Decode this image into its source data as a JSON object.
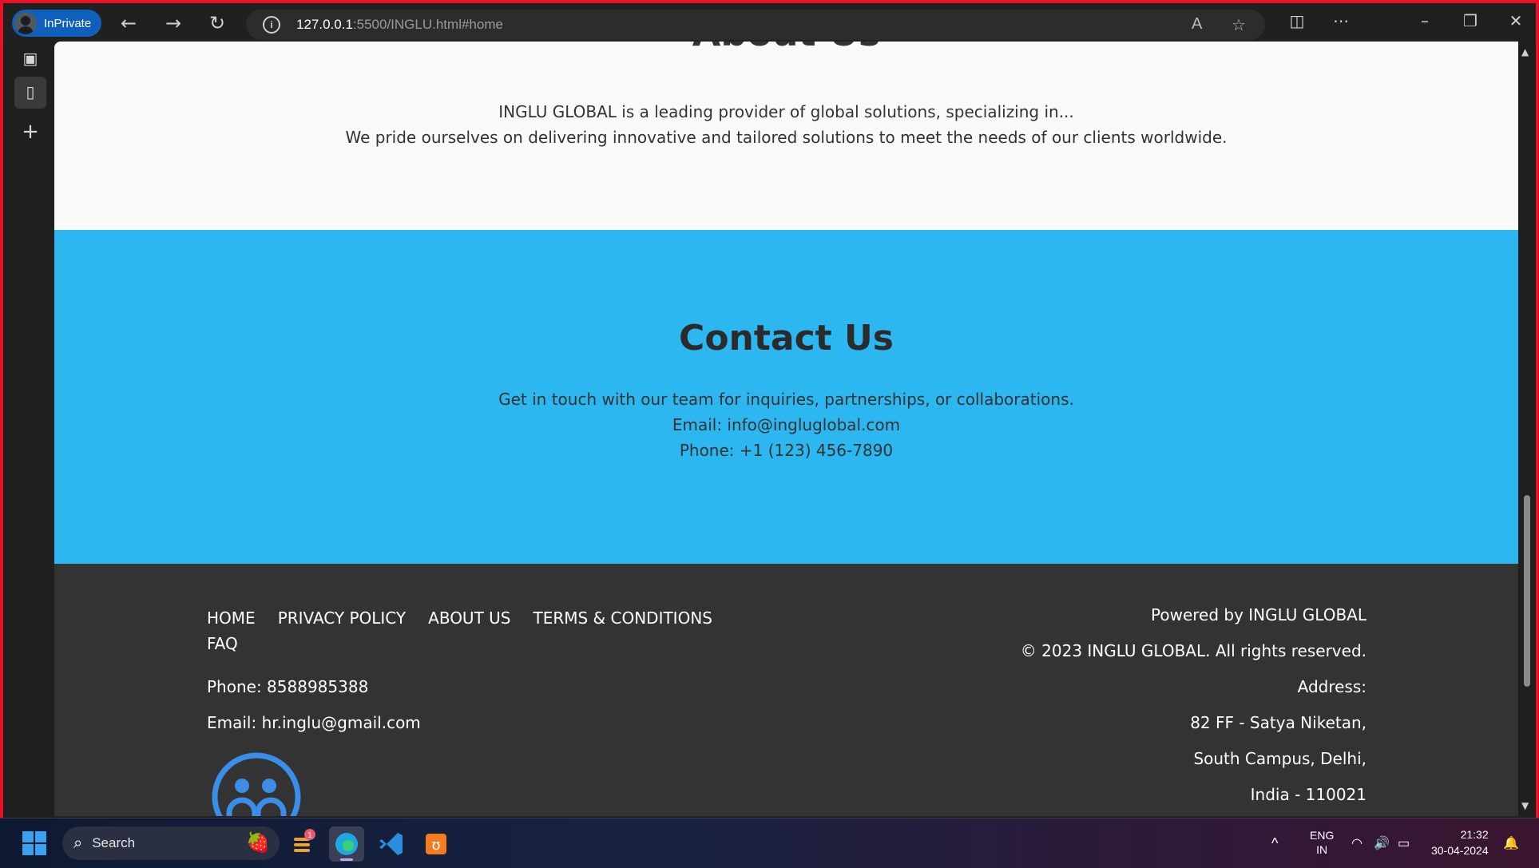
{
  "browser": {
    "profile_label": "InPrivate",
    "url_host": "127.0.0.1",
    "url_path": ":5500/INGLU.html#home"
  },
  "about": {
    "heading": "About Us",
    "line1": "INGLU GLOBAL is a leading provider of global solutions, specializing in...",
    "line2": "We pride ourselves on delivering innovative and tailored solutions to meet the needs of our clients worldwide."
  },
  "contact": {
    "heading": "Contact Us",
    "intro": "Get in touch with our team for inquiries, partnerships, or collaborations.",
    "email": "Email: info@ingluglobal.com",
    "phone": "Phone: +1 (123) 456-7890"
  },
  "footer": {
    "nav": [
      "HOME",
      "PRIVACY POLICY",
      "ABOUT US",
      "TERMS & CONDITIONS",
      "FAQ"
    ],
    "phone": "Phone: 8588985388",
    "email": "Email: hr.inglu@gmail.com",
    "powered_by": "Powered by INGLU GLOBAL",
    "copyright": "© 2023 INGLU GLOBAL. All rights reserved.",
    "address_label": "Address:",
    "address_line1": "82 FF - Satya Niketan,",
    "address_line2": "South Campus, Delhi,",
    "address_line3": "India - 110021"
  },
  "taskbar": {
    "search_label": "Search",
    "notification_count": "1",
    "lang_line1": "ENG",
    "lang_line2": "IN",
    "time": "21:32",
    "date": "30-04-2024"
  },
  "colors": {
    "contact_bg": "#2db7f0",
    "footer_bg": "#333333",
    "inprivate_border": "#e81123",
    "logo_blue": "#3b8ee8"
  }
}
